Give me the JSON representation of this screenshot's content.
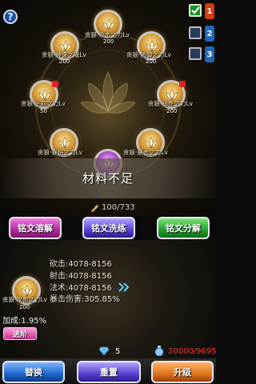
{
  "help_label": "?",
  "tabs": [
    {
      "number": "1",
      "checked": true
    },
    {
      "number": "2",
      "checked": false
    },
    {
      "number": "3",
      "checked": false
    }
  ],
  "slots": [
    {
      "label": "贪狼·攻击之力Lv",
      "value": "200"
    },
    {
      "label": "贪狼·神速之魂Lv",
      "value": "200"
    },
    {
      "label": "贪狼·防御之力Lv",
      "value": "200"
    },
    {
      "label": "贪狼·生命之力Lv",
      "value": "50"
    },
    {
      "label": "贪狼·韧性之力Lv",
      "value": "200"
    },
    {
      "label": "贪狼·暴伤之力Lv",
      "value": ""
    },
    {
      "label": "贪狼·暴击之力Lv",
      "value": ""
    }
  ],
  "title": "材料不足",
  "materials": "100/733",
  "buttons": {
    "dissolve": "铭文溶解",
    "wash": "铭文洗练",
    "decompose": "铭文分解",
    "advance": "进阶",
    "replace": "替换",
    "reset": "重置",
    "upgrade": "升级"
  },
  "selected": {
    "label": "贪狼·攻击之力Lv",
    "value": "200"
  },
  "stats": [
    "砍击:4078-8156",
    "射击:4078-8156",
    "法术:4078-8156",
    "暴击伤害:305.85%"
  ],
  "bonus": "加成:1.95%",
  "diamonds": "5",
  "potion": "20000/9695"
}
